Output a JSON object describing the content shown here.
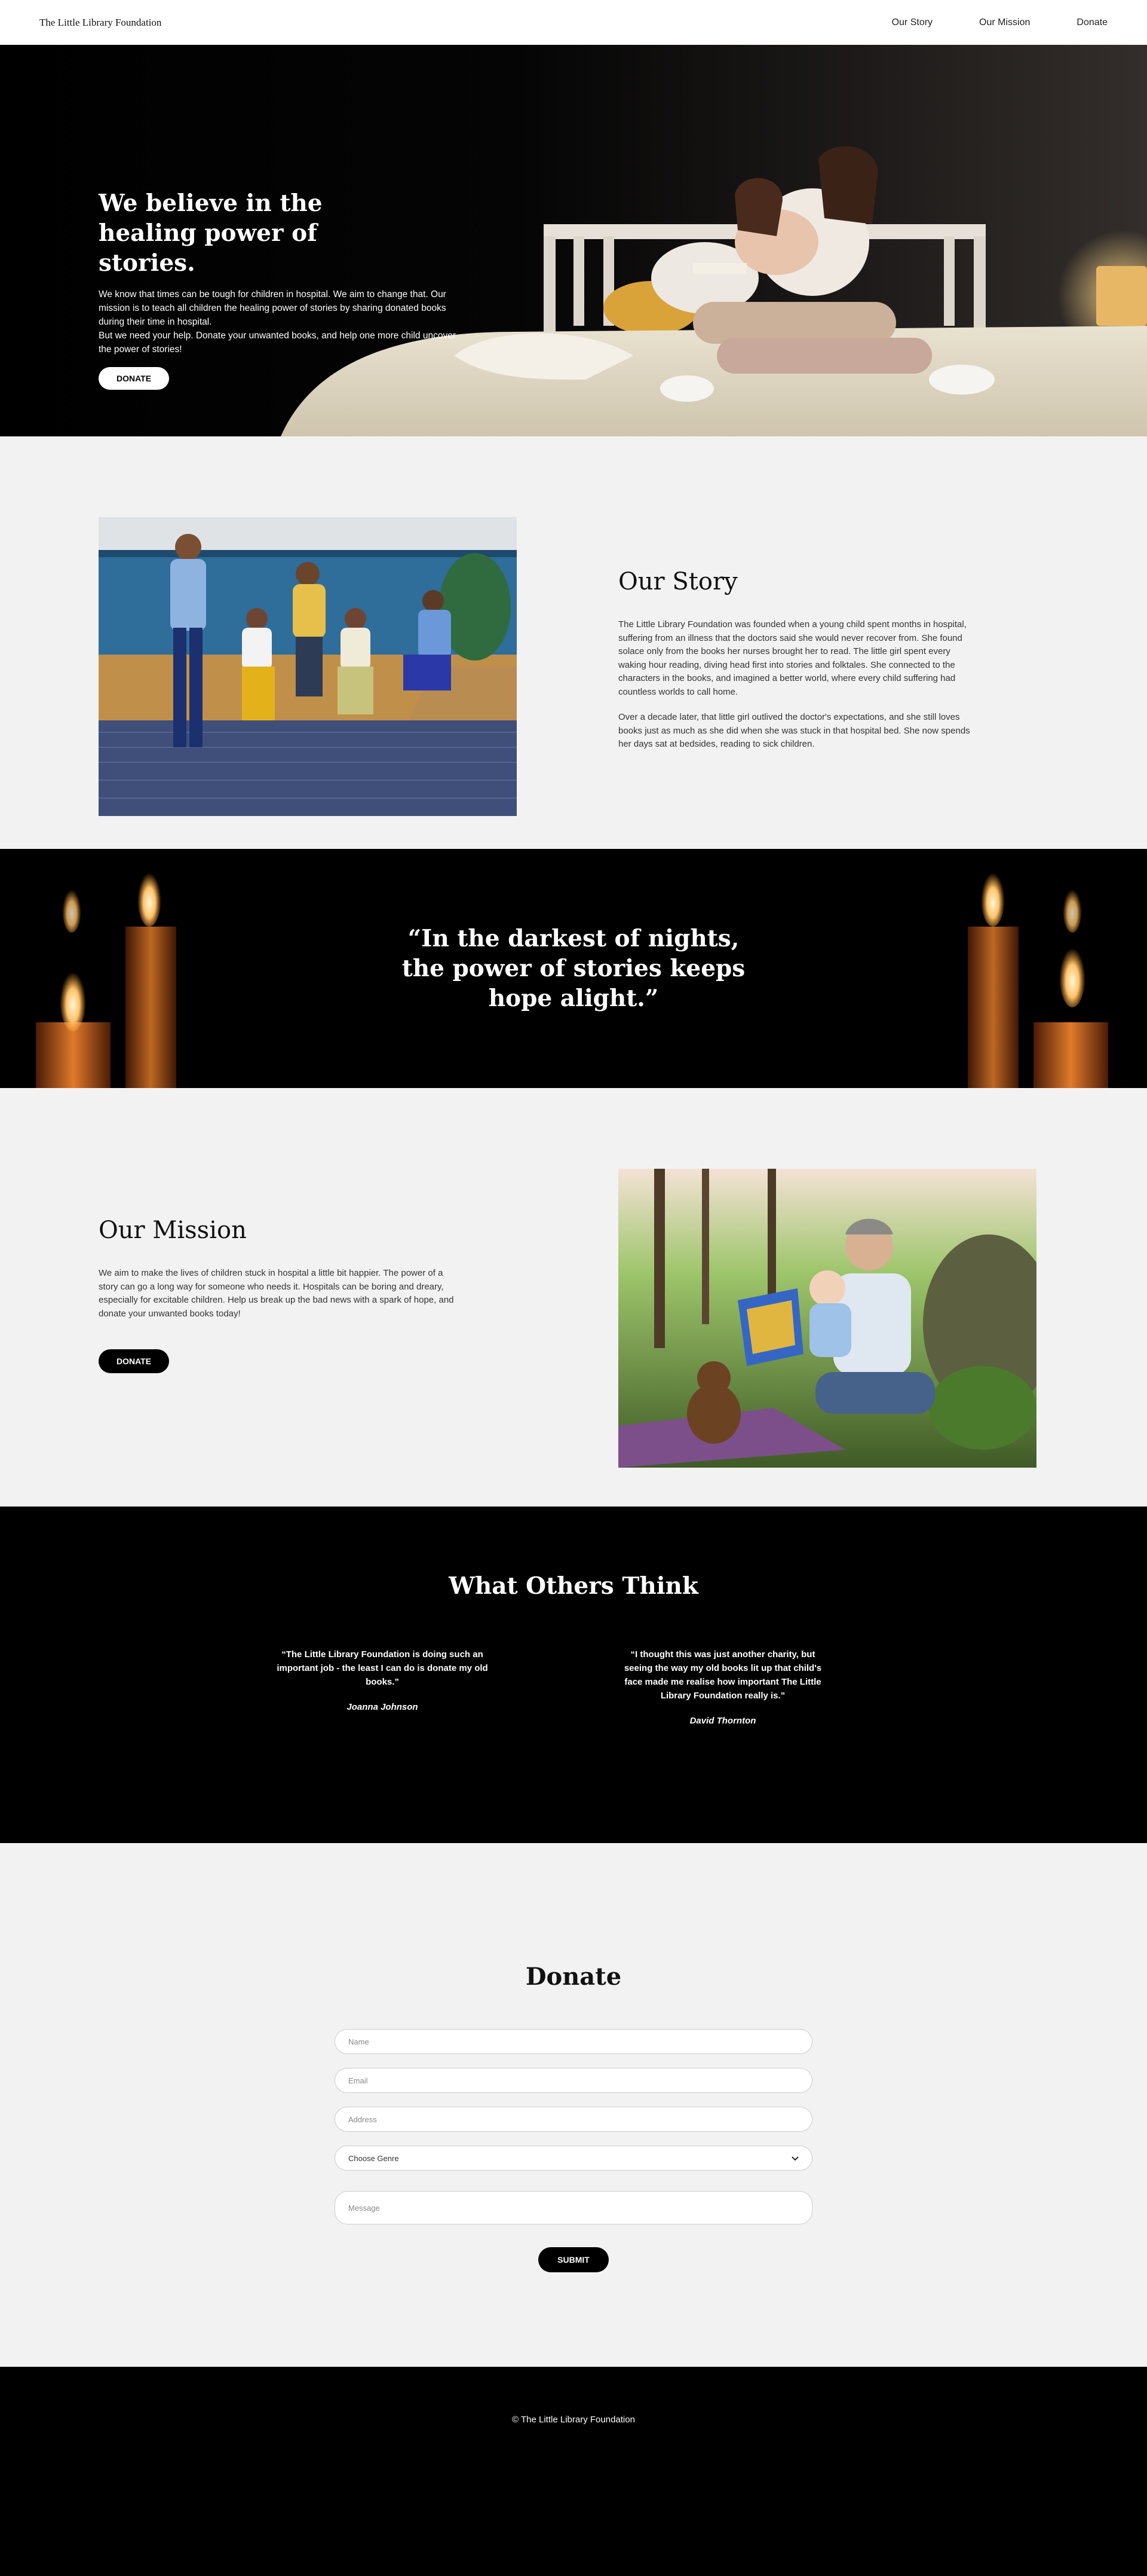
{
  "nav": {
    "brand": "The Little Library Foundation",
    "links": [
      "Our Story",
      "Our Mission",
      "Donate"
    ]
  },
  "hero": {
    "title": "We believe in the healing power of stories.",
    "body_line1": "We know that times can be tough for children in hospital. We aim to change that. Our mission is to teach all children the healing power of stories by sharing donated books during their time in hospital.",
    "body_line2": "But we need your help. Donate your unwanted books, and help one more child uncover the power of stories!",
    "button": "DONATE"
  },
  "story": {
    "title": "Our Story",
    "p1": "The Little Library Foundation was founded when a young child spent months in hospital, suffering from an illness that the doctors said she would never recover from. She found solace only from the books her nurses brought her to read. The little girl spent every waking hour reading, diving head first into stories and folktales. She connected to the characters in the books, and imagined a better world, where every child suffering had countless worlds to call home.",
    "p2": "Over a decade later, that little girl outlived the doctor's expectations, and she still loves books just as much as she did when she was stuck in that hospital bed. She now spends her days sat at bedsides, reading to sick children."
  },
  "quote": {
    "text": "“In the darkest of nights, the power of stories keeps hope alight.”"
  },
  "mission": {
    "title": "Our Mission",
    "p1": "We aim to make the lives of children stuck in hospital a little bit happier. The power of a story can go a long way for someone who needs it. Hospitals can be boring and dreary, especially for excitable children. Help us break up the bad news with a spark of hope, and donate your unwanted books today!",
    "button": "DONATE"
  },
  "testimonials": {
    "title": "What Others Think",
    "items": [
      {
        "quote": "“The Little Library Foundation is doing such an important job - the least I can do is donate my old books.”",
        "author": "Joanna Johnson"
      },
      {
        "quote": "“I thought this was just another charity, but seeing the way my old books lit up that child's face made me realise how important The Little Library Foundation really is.”",
        "author": "David Thornton"
      }
    ]
  },
  "donate": {
    "title": "Donate",
    "name_placeholder": "Name",
    "email_placeholder": "Email",
    "address_placeholder": "Address",
    "genre_selected": "Choose Genre",
    "message_placeholder": "Message",
    "submit": "SUBMIT"
  },
  "footer": {
    "text": "© The Little Library Foundation"
  },
  "icons": {
    "select_arrow": "chevron-down-icon"
  }
}
